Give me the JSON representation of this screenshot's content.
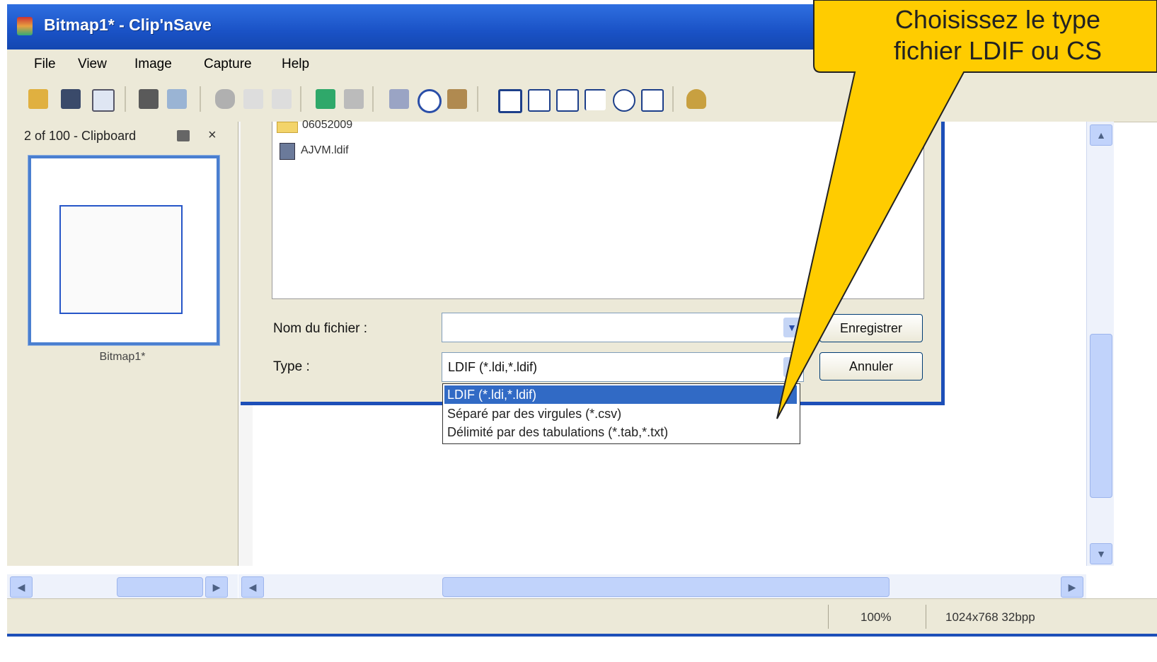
{
  "window": {
    "title": "Bitmap1* - Clip'nSave"
  },
  "menu": {
    "items": [
      "File",
      "View",
      "Image",
      "Capture",
      "Help"
    ]
  },
  "clipboard_panel": {
    "header": "2 of 100 - Clipboard",
    "close_glyph": "×",
    "thumbnail_caption": "Bitmap1*"
  },
  "save_dialog": {
    "files": [
      {
        "name": "06052009",
        "icon": "folder-icon"
      },
      {
        "name": "AJVM.ldif",
        "icon": "file-icon"
      }
    ],
    "filename_label": "Nom du fichier :",
    "filename_value": "",
    "type_label": "Type :",
    "type_value": "LDIF (*.ldi,*.ldif)",
    "save_button": "Enregistrer",
    "cancel_button": "Annuler",
    "type_options": [
      "LDIF (*.ldi,*.ldif)",
      "Séparé par des virgules (*.csv)",
      "Délimité par des tabulations (*.tab,*.txt)"
    ],
    "selected_option_index": 0
  },
  "status": {
    "zoom": "100%",
    "dimensions": "1024x768 32bpp"
  },
  "callout": {
    "line1": "Choisissez le type",
    "line2": "fichier LDIF ou CS"
  },
  "colors": {
    "titlebar": "#1a52c6",
    "callout_fill": "#ffcc00",
    "selection": "#316ac5",
    "xp_face": "#ece9d8"
  }
}
